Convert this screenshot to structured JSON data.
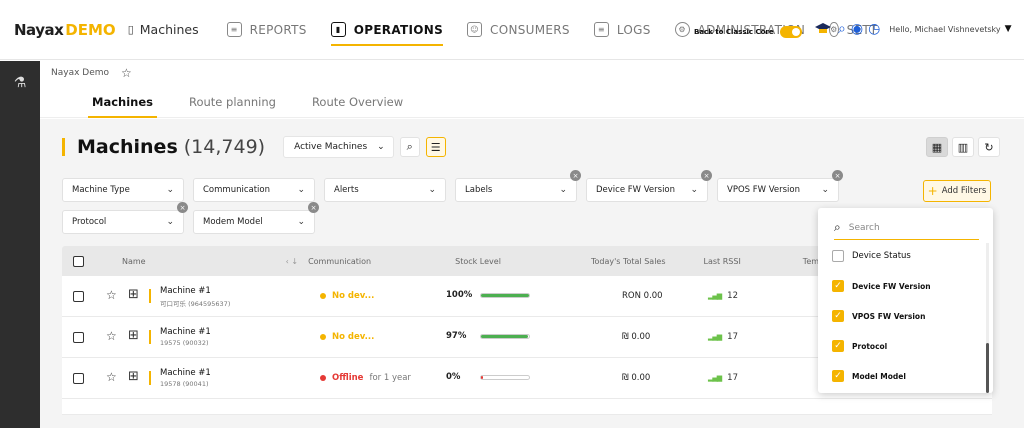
{
  "brand": {
    "name": "Nayax",
    "env": "DEMO",
    "module": "Machines"
  },
  "nav": [
    {
      "label": "REPORTS",
      "icon": "reports-icon"
    },
    {
      "label": "OPERATIONS",
      "icon": "operations-icon",
      "active": true
    },
    {
      "label": "CONSUMERS",
      "icon": "consumers-icon"
    },
    {
      "label": "LOGS",
      "icon": "logs-icon"
    },
    {
      "label": "ADMINISTRATION",
      "icon": "administration-icon"
    },
    {
      "label": "SETTINGS",
      "icon": "settings-icon"
    }
  ],
  "classic_toggle": {
    "label": "Back to Classic Core",
    "on": true
  },
  "user": {
    "greeting": "Hello, Michael Vishnevetsky"
  },
  "breadcrumb": {
    "label": "Nayax Demo"
  },
  "subtabs": [
    {
      "label": "Machines",
      "active": true
    },
    {
      "label": "Route planning"
    },
    {
      "label": "Route Overview"
    }
  ],
  "page": {
    "title": "Machines",
    "count": "(14,749)",
    "view_filter": "Active Machines"
  },
  "filters": [
    "Machine Type",
    "Communication",
    "Alerts",
    "Labels",
    "Device FW Version",
    "VPOS FW Version",
    "Protocol",
    "Modem Model"
  ],
  "add_filters_label": "Add Filters",
  "table": {
    "headers": {
      "name": "Name",
      "communication": "Communication",
      "stock": "Stock Level",
      "sales": "Today's Total Sales",
      "rssi": "Last RSSI",
      "temp": "Temp"
    },
    "rows": [
      {
        "name": "Machine #1",
        "id": "可口可乐 (964595637)",
        "status": "No dev...",
        "status_extra": "",
        "stock": "100%",
        "stock_fraction": 1.0,
        "sales": "RON 0.00",
        "rssi": "12"
      },
      {
        "name": "Machine #1",
        "id": "19575 (90032)",
        "status": "No dev...",
        "status_extra": "",
        "stock": "97%",
        "stock_fraction": 0.97,
        "sales": "₪ 0.00",
        "rssi": "17"
      },
      {
        "name": "Machine #1",
        "id": "19578 (90041)",
        "status": "Offline",
        "status_extra": "for 1 year",
        "stock": "0%",
        "stock_fraction": 0.0,
        "sales": "₪ 0.00",
        "rssi": "17"
      }
    ]
  },
  "dropdown": {
    "search_placeholder": "Search",
    "items": [
      {
        "label": "Device Status",
        "checked": false
      },
      {
        "label": "Device FW Version",
        "checked": true
      },
      {
        "label": "VPOS FW Version",
        "checked": true
      },
      {
        "label": "Protocol",
        "checked": true
      },
      {
        "label": "Model Model",
        "checked": true
      }
    ]
  },
  "colors": {
    "accent": "#f4b400",
    "sidebar": "#2e2e2e",
    "offline": "#e53935",
    "nodev": "#f4b400",
    "stock_ok": "#4caf50",
    "signal": "#6cc24a"
  }
}
